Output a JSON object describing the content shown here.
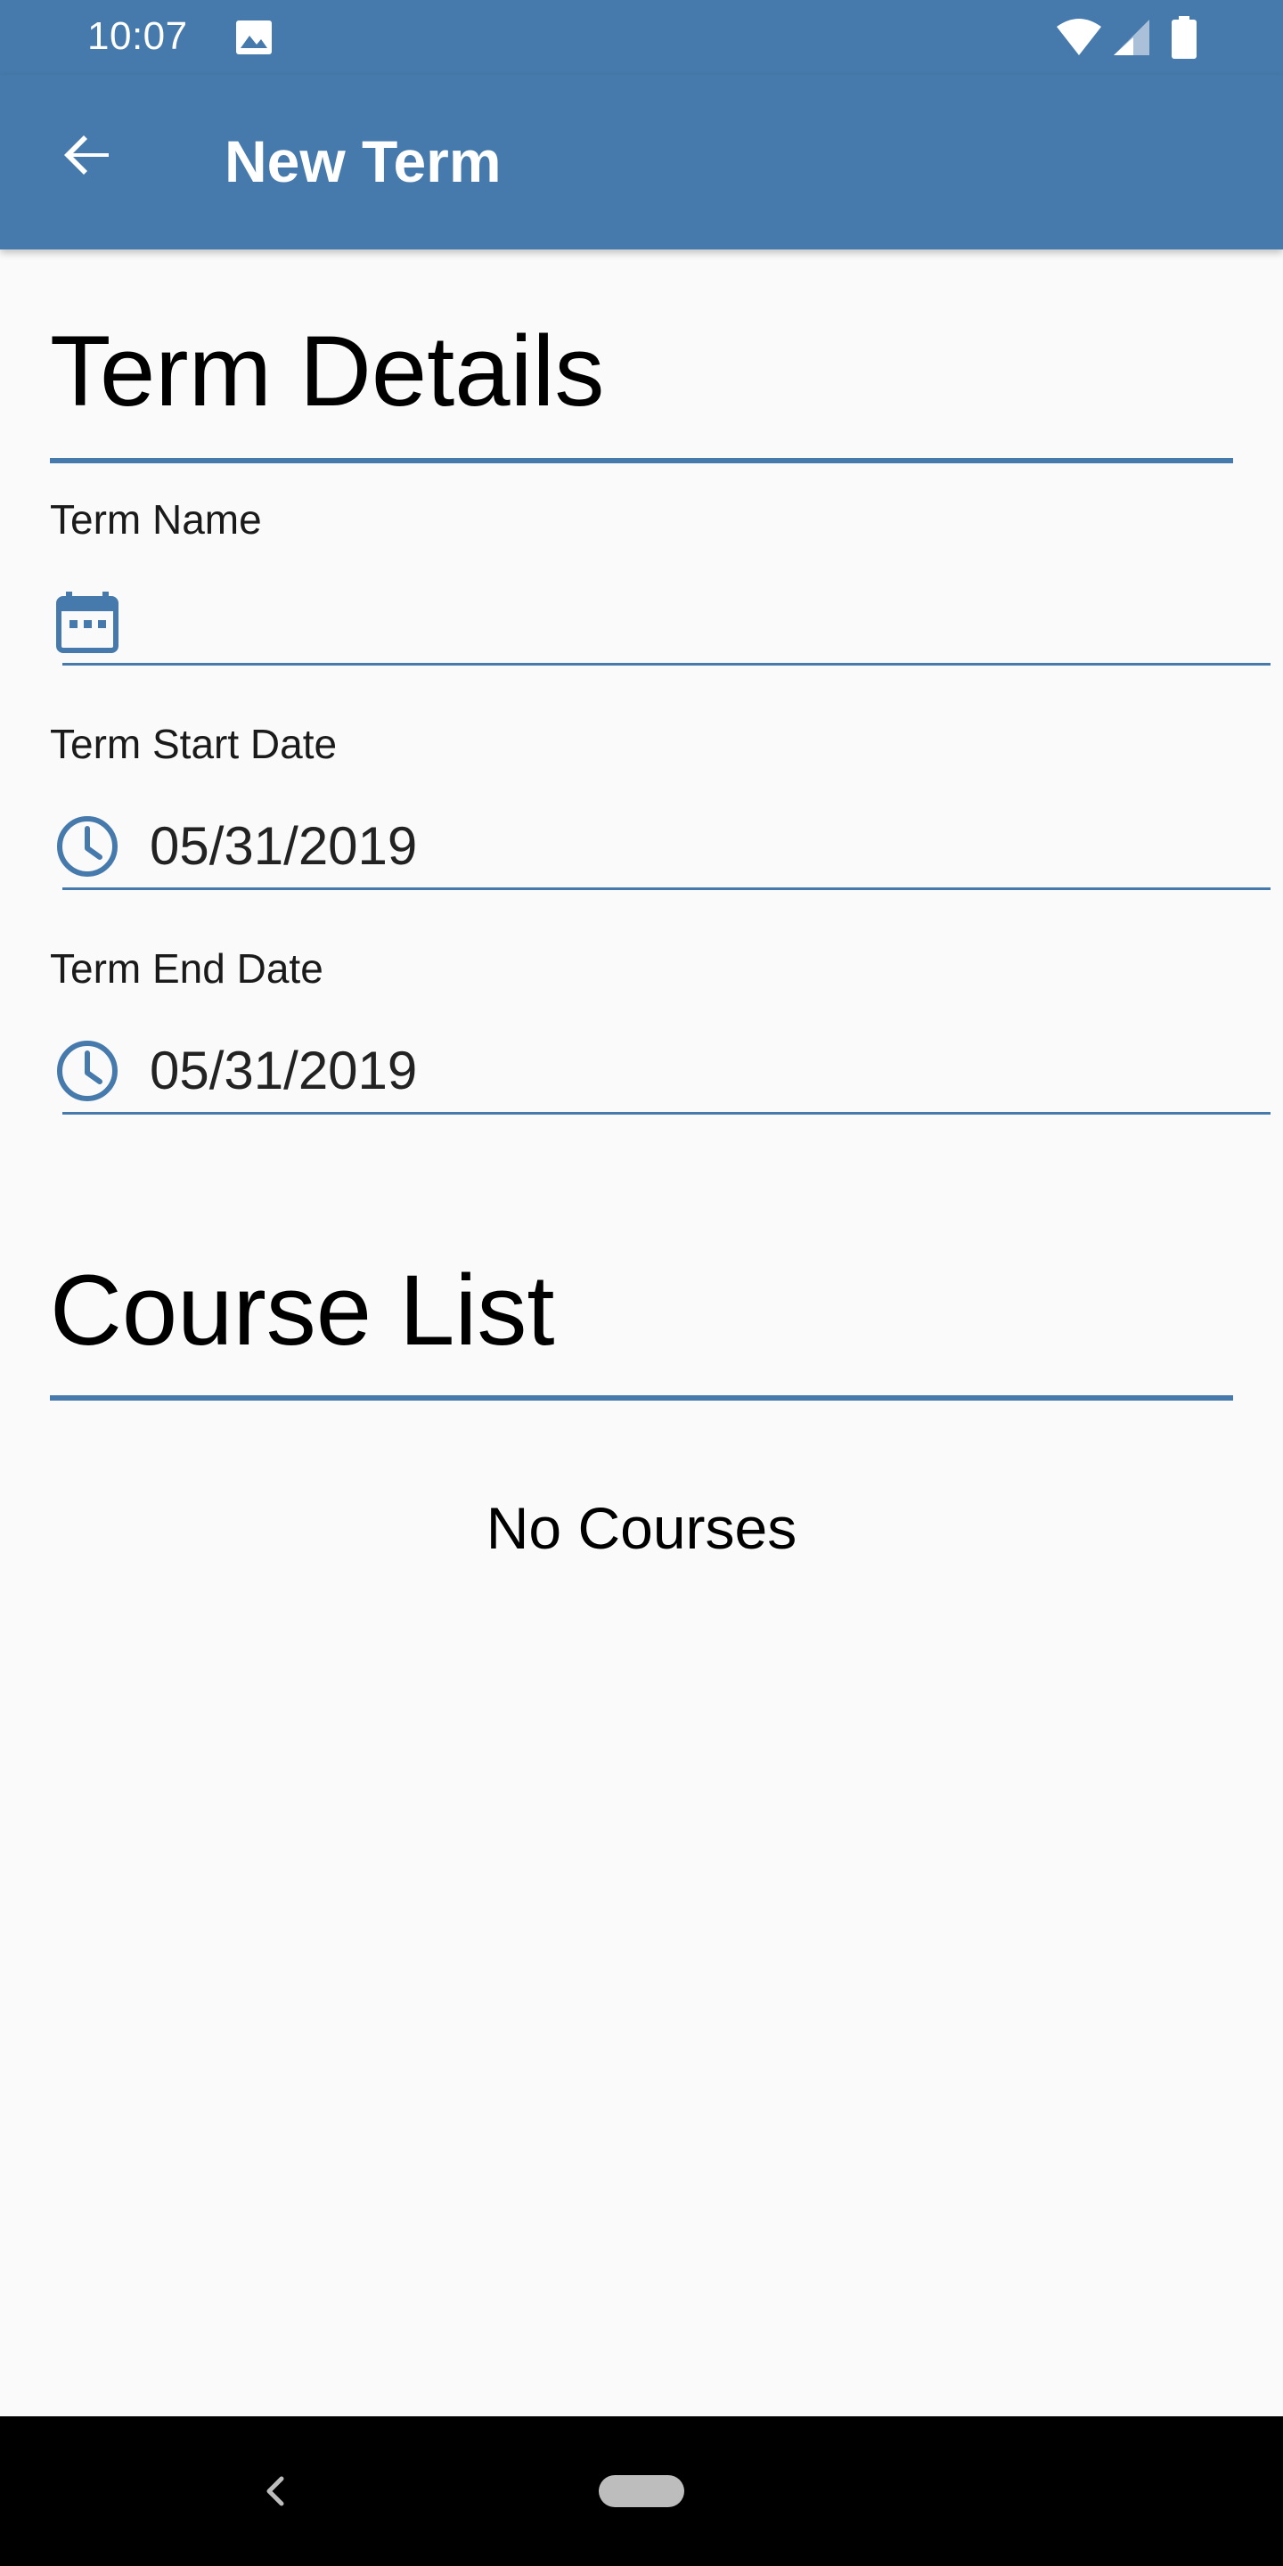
{
  "status_bar": {
    "time": "10:07",
    "icons": [
      "image-icon",
      "wifi-icon",
      "signal-icon",
      "battery-icon"
    ]
  },
  "app_bar": {
    "title": "New Term",
    "back_icon": "arrow-back-icon"
  },
  "term_details": {
    "heading": "Term Details",
    "fields": [
      {
        "label": "Term Name",
        "value": "",
        "icon": "calendar-icon"
      },
      {
        "label": "Term Start Date",
        "value": "05/31/2019",
        "icon": "clock-icon"
      },
      {
        "label": "Term End Date",
        "value": "05/31/2019",
        "icon": "clock-icon"
      }
    ]
  },
  "course_list": {
    "heading": "Course List",
    "empty_message": "No Courses"
  },
  "nav_bar": {
    "icons": [
      "nav-back-icon",
      "home-pill-icon"
    ]
  },
  "colors": {
    "primary": "#467aac",
    "background": "#fafafa",
    "nav_bar": "#000000"
  }
}
